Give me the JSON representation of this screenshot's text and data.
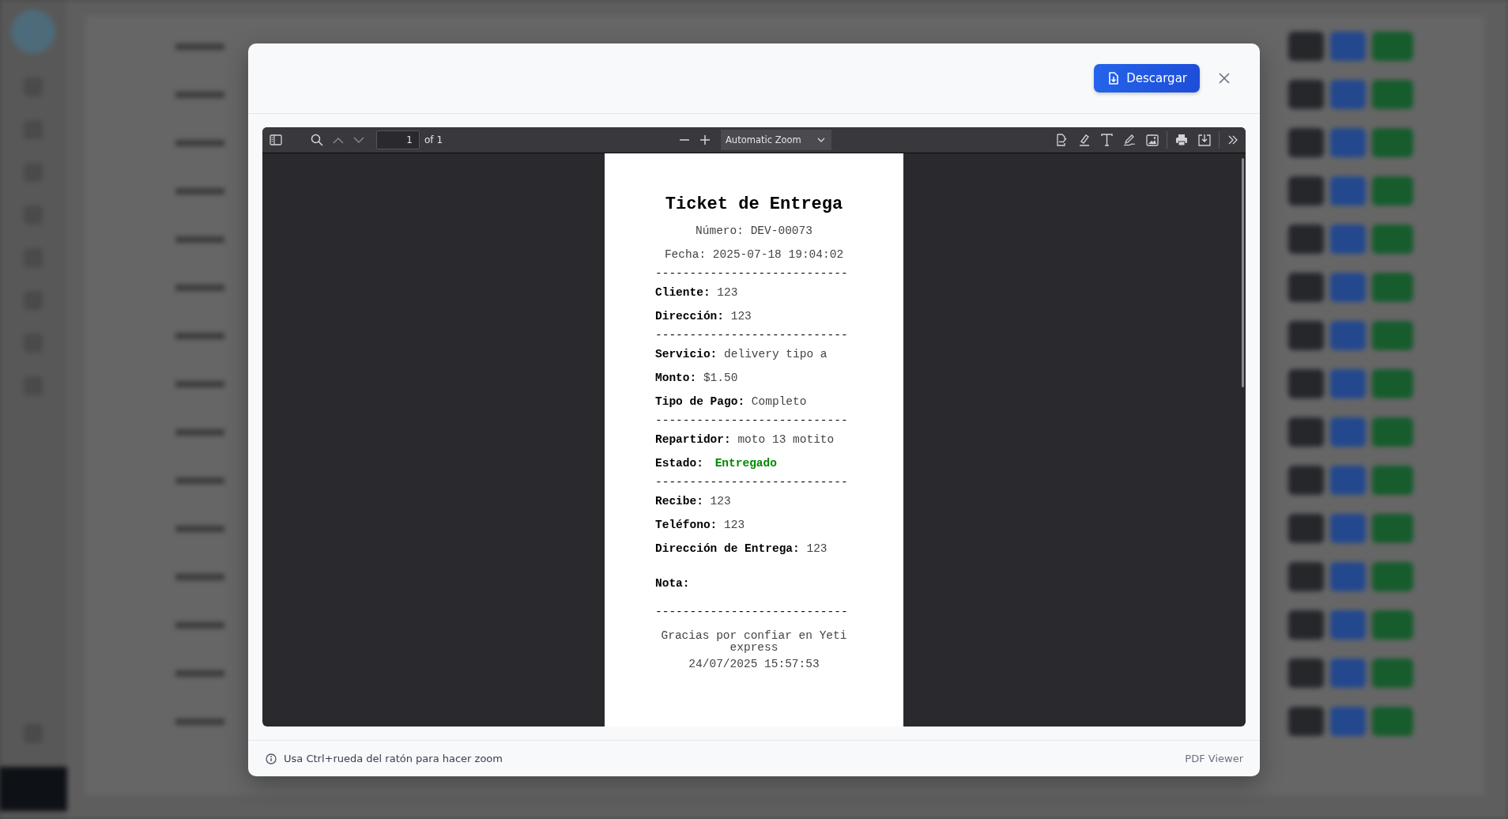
{
  "dialog": {
    "download_button": "Descargar"
  },
  "viewer": {
    "toolbar": {
      "page_number": "1",
      "page_count": "of 1",
      "zoom": "Automatic Zoom"
    },
    "document": {
      "title": "Ticket de Entrega",
      "lines": [
        {
          "kind": "center",
          "text": "Número: DEV-00073"
        },
        {
          "kind": "center",
          "text": "Fecha: 2025-07-18 19:04:02"
        },
        {
          "kind": "rule",
          "text": "----------------------------"
        },
        {
          "kind": "field",
          "label": "Cliente:",
          "value": "123"
        },
        {
          "kind": "field",
          "label": "Dirección:",
          "value": "123"
        },
        {
          "kind": "rule",
          "text": "----------------------------"
        },
        {
          "kind": "field",
          "label": "Servicio:",
          "value": "delivery tipo a"
        },
        {
          "kind": "field",
          "label": "Monto:",
          "value": "$1.50"
        },
        {
          "kind": "field",
          "label": "Tipo de Pago:",
          "value": "Completo"
        },
        {
          "kind": "rule",
          "text": "----------------------------"
        },
        {
          "kind": "field",
          "label": "Repartidor:",
          "value": "moto 13 motito"
        },
        {
          "kind": "status",
          "label": "Estado:",
          "value": "Entregado"
        },
        {
          "kind": "rule",
          "text": "----------------------------"
        },
        {
          "kind": "field",
          "label": "Recibe:",
          "value": "123"
        },
        {
          "kind": "field",
          "label": "Teléfono:",
          "value": "123"
        },
        {
          "kind": "field",
          "label": "Dirección de Entrega:",
          "value": "123"
        },
        {
          "kind": "note",
          "label": "Nota:"
        },
        {
          "kind": "rule",
          "text": "----------------------------"
        },
        {
          "kind": "footer",
          "text": "Gracias por confiar en Yeti express"
        },
        {
          "kind": "center",
          "text": "24/07/2025 15:57:53"
        }
      ]
    }
  },
  "footer": {
    "hint": "Usa Ctrl+rueda del ratón para hacer zoom",
    "viewer_label": "PDF Viewer"
  }
}
